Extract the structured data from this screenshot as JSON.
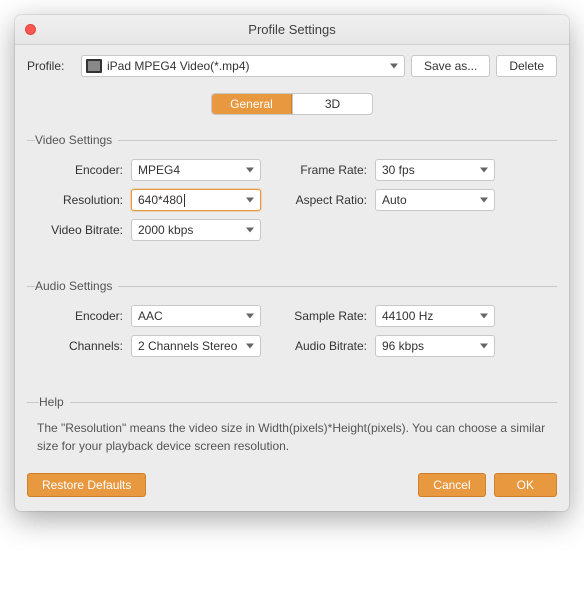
{
  "window": {
    "title": "Profile Settings"
  },
  "profile": {
    "label": "Profile:",
    "value": "iPad MPEG4 Video(*.mp4)",
    "save_as": "Save as...",
    "delete": "Delete"
  },
  "tabs": {
    "general": "General",
    "three_d": "3D"
  },
  "video": {
    "legend": "Video Settings",
    "encoder_label": "Encoder:",
    "encoder_value": "MPEG4",
    "framerate_label": "Frame Rate:",
    "framerate_value": "30 fps",
    "resolution_label": "Resolution:",
    "resolution_value": "640*480",
    "aspect_label": "Aspect Ratio:",
    "aspect_value": "Auto",
    "bitrate_label": "Video Bitrate:",
    "bitrate_value": "2000 kbps"
  },
  "audio": {
    "legend": "Audio Settings",
    "encoder_label": "Encoder:",
    "encoder_value": "AAC",
    "samplerate_label": "Sample Rate:",
    "samplerate_value": "44100 Hz",
    "channels_label": "Channels:",
    "channels_value": "2 Channels Stereo",
    "bitrate_label": "Audio Bitrate:",
    "bitrate_value": "96 kbps"
  },
  "help": {
    "legend": "Help",
    "text": "The \"Resolution\" means the video size in Width(pixels)*Height(pixels).  You can choose a similar size for your playback device screen resolution."
  },
  "buttons": {
    "restore": "Restore Defaults",
    "cancel": "Cancel",
    "ok": "OK"
  },
  "colors": {
    "accent": "#e8983e"
  }
}
